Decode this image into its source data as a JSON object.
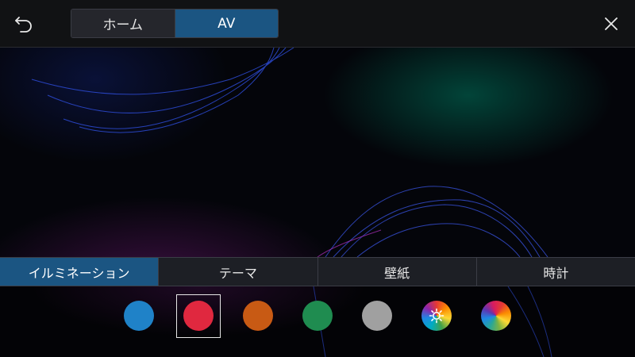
{
  "header": {
    "back_icon": "back-arrow-icon",
    "close_icon": "close-icon",
    "mode_tabs": [
      {
        "label": "ホーム",
        "active": false
      },
      {
        "label": "AV",
        "active": true
      }
    ]
  },
  "settings_tabs": [
    {
      "label": "イルミネーション",
      "active": true
    },
    {
      "label": "テーマ",
      "active": false
    },
    {
      "label": "壁紙",
      "active": false
    },
    {
      "label": "時計",
      "active": false
    }
  ],
  "colors": {
    "accent": "#1b5582",
    "swatches": [
      {
        "name": "blue",
        "color": "#1f82c8",
        "selected": false
      },
      {
        "name": "red",
        "color": "#e0283f",
        "selected": true
      },
      {
        "name": "orange",
        "color": "#c85a14",
        "selected": false
      },
      {
        "name": "green",
        "color": "#1f8c50",
        "selected": false
      },
      {
        "name": "gray",
        "color": "#a0a0a0",
        "selected": false
      },
      {
        "name": "custom-adjust",
        "color": "rainbow-gear",
        "selected": false
      },
      {
        "name": "rainbow",
        "color": "rainbow",
        "selected": false
      }
    ]
  }
}
